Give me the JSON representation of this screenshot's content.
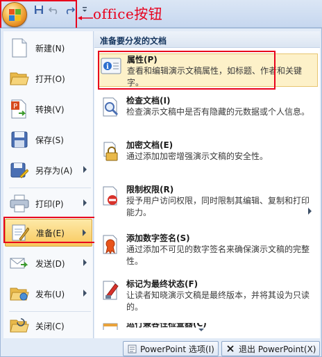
{
  "annotation": {
    "office_label": "office按钮",
    "color": "#e8001c"
  },
  "quick_access": {
    "icons": [
      "save-icon",
      "undo-icon",
      "redo-icon",
      "customize-icon"
    ]
  },
  "left_menu": {
    "items": [
      {
        "label": "新建(N)",
        "icon": "new-document-icon",
        "has_submenu": false
      },
      {
        "label": "打开(O)",
        "icon": "open-folder-icon",
        "has_submenu": false
      },
      {
        "label": "转换(V)",
        "icon": "convert-icon",
        "has_submenu": false
      },
      {
        "label": "保存(S)",
        "icon": "floppy-disk-icon",
        "has_submenu": false
      },
      {
        "label": "另存为(A)",
        "icon": "save-as-icon",
        "has_submenu": true
      },
      {
        "label": "打印(P)",
        "icon": "printer-icon",
        "has_submenu": true
      },
      {
        "label": "准备(E)",
        "icon": "prepare-icon",
        "has_submenu": true,
        "active": true
      },
      {
        "label": "发送(D)",
        "icon": "send-icon",
        "has_submenu": true
      },
      {
        "label": "发布(U)",
        "icon": "publish-icon",
        "has_submenu": true
      },
      {
        "label": "关闭(C)",
        "icon": "close-folder-icon",
        "has_submenu": false
      }
    ]
  },
  "right_panel": {
    "header": "准备要分发的文档",
    "items": [
      {
        "title": "属性(P)",
        "desc": "查看和编辑演示文稿属性，如标题、作者和关键字。",
        "icon": "properties-icon"
      },
      {
        "title": "检查文档(I)",
        "desc": "检查演示文稿中是否有隐藏的元数据或个人信息。",
        "icon": "inspect-document-icon"
      },
      {
        "title": "加密文档(E)",
        "desc": "通过添加加密增强演示文稿的安全性。",
        "icon": "encrypt-lock-icon"
      },
      {
        "title": "限制权限(R)",
        "desc": "授予用户访问权限，同时限制其编辑、复制和打印能力。",
        "icon": "restrict-permission-icon"
      },
      {
        "title": "添加数字签名(S)",
        "desc": "通过添加不可见的数字签名来确保演示文稿的完整性。",
        "icon": "digital-signature-icon"
      },
      {
        "title": "标记为最终状态(F)",
        "desc": "让读者知晓演示文稿是最终版本，并将其设为只读的。",
        "icon": "mark-final-icon"
      },
      {
        "title": "运行兼容性检查器(C)",
        "desc": "",
        "icon": "compatibility-checker-icon"
      }
    ]
  },
  "footer": {
    "options_label": "PowerPoint 选项(I)",
    "exit_label": "退出 PowerPoint(X)"
  }
}
